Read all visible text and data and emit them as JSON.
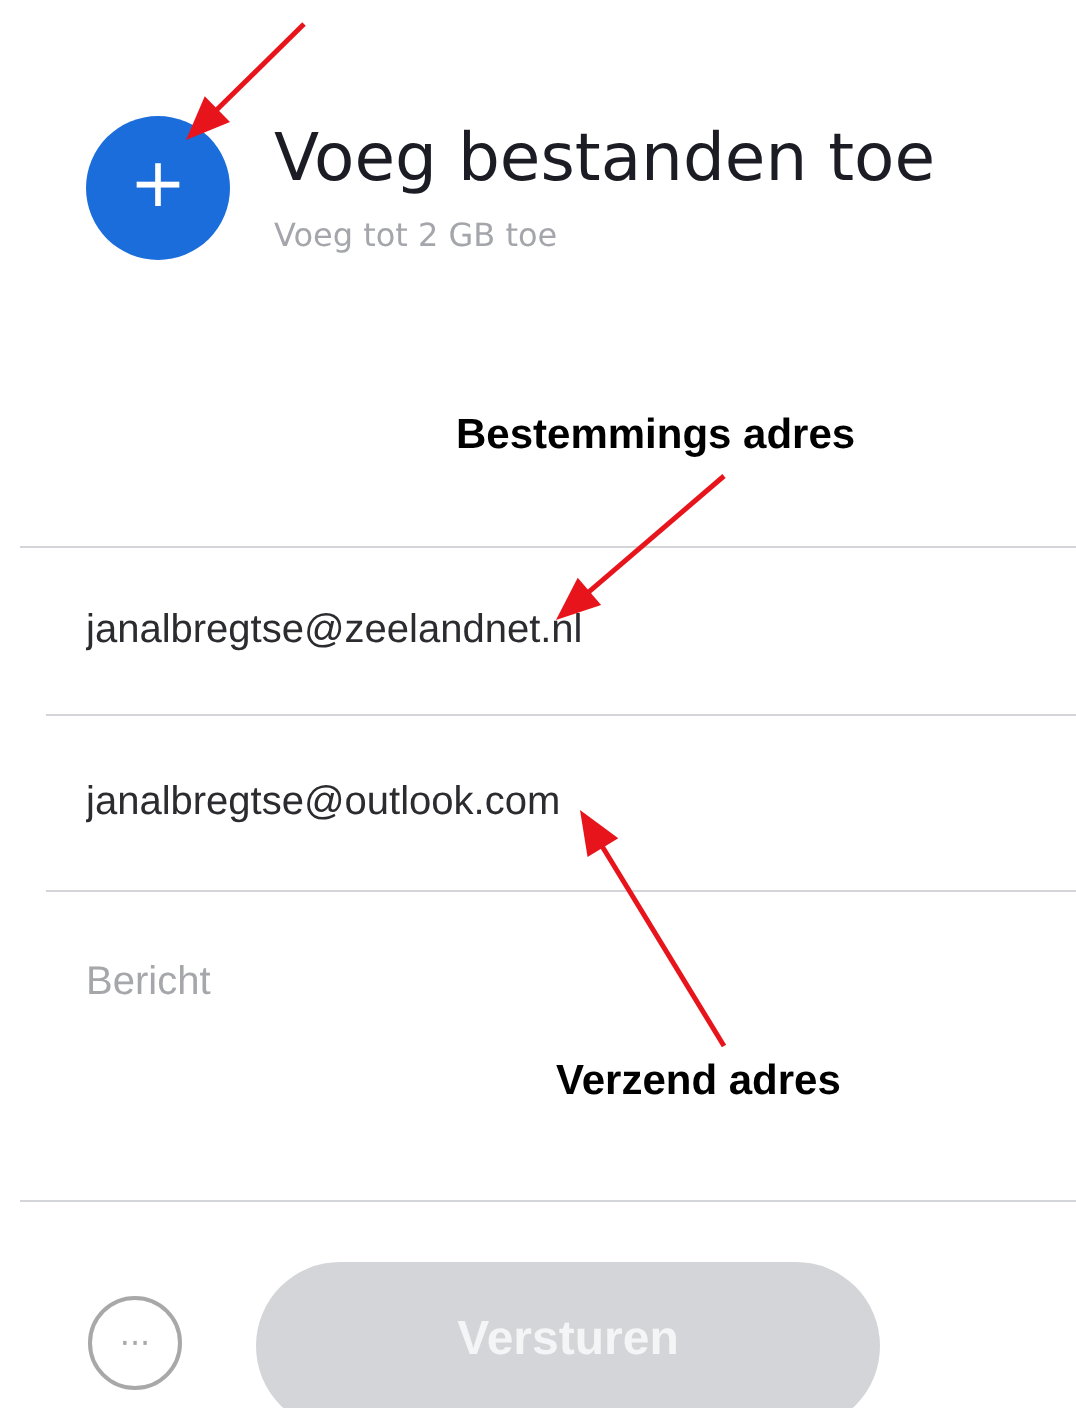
{
  "upload": {
    "button_label": "+",
    "title": "Voeg bestanden toe",
    "subtitle": "Voeg tot 2 GB toe"
  },
  "annotations": [
    {
      "text": "Bestemmings adres"
    },
    {
      "text": "Verzend adres"
    }
  ],
  "fields": [
    {
      "kind": "email",
      "value": "janalbregtse@zeelandnet.nl"
    },
    {
      "kind": "email",
      "value": "janalbregtse@outlook.com"
    },
    {
      "kind": "message",
      "placeholder": "Bericht"
    }
  ],
  "footer": {
    "more_label": "···",
    "send_button": {
      "label": "Versturen",
      "disabled": true
    }
  }
}
